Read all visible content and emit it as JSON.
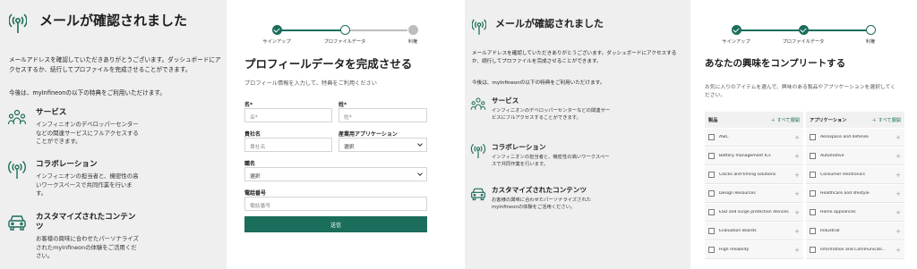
{
  "left": {
    "title": "メールが確認されました",
    "intro": "メールアドレスを確認していただきありがとうございます。ダッシュボードにアクセスするか、続行してプロファイルを完成させることができます。",
    "now_line": "今後は、myInfineonの以下の特典をご利用いただけます。",
    "features": [
      {
        "name": "サービス",
        "desc": "インフィニオンのデベロッパーセンターなどの関連サービスにフルアクセスすることができます。",
        "icon": "people-icon"
      },
      {
        "name": "コラボレーション",
        "desc": "インフィニオンの担当者と、機密性の高いワークスペースで共同作業を行います。",
        "icon": "antenna-icon"
      },
      {
        "name": "カスタマイズされたコンテンツ",
        "desc": "お客様の興味に合わせたパーソナライズされたmyInfineonの体験をご活用ください。",
        "icon": "car-icon"
      }
    ]
  },
  "steps": {
    "labels": [
      "サインアップ",
      "プロファイルデータ",
      "利権"
    ]
  },
  "form": {
    "title": "プロフィールデータを完成させる",
    "subtitle": "プロフィール情報を入力して、特典をご利用ください",
    "first_name_label": "名*",
    "first_name_placeholder": "名*",
    "last_name_label": "姓*",
    "last_name_placeholder": "姓*",
    "company_label": "貴社名",
    "company_placeholder": "貴社名",
    "application_label": "産業用アプリケーション",
    "application_value": "選択",
    "job_label": "職名",
    "job_value": "選択",
    "phone_label": "電話番号",
    "phone_placeholder": "電話番号",
    "submit_label": "送信"
  },
  "interests": {
    "title": "あなたの興味をコンプリートする",
    "subtitle": "お気に入りのアイテムを選んで、興味のある製品やアプリケーションを選択してください。",
    "products_header": "製品",
    "applications_header": "アプリケーション",
    "expand_all": "＋ すべて展開",
    "products": [
      "ASIC",
      "Battery management ICs",
      "Clocks and timing solutions",
      "Design Resources",
      "ESD and surge protection devices",
      "Evaluation Boards",
      "High reliability"
    ],
    "applications": [
      "Aerospace and defense",
      "Automotive",
      "Consumer electronics",
      "Healthcare and lifestyle",
      "Home appliances",
      "Industrial",
      "Information and Communicati..."
    ]
  },
  "colors": {
    "accent": "#1b6e5b",
    "panel_bg": "#efefef",
    "card_bg": "#ffffff"
  }
}
